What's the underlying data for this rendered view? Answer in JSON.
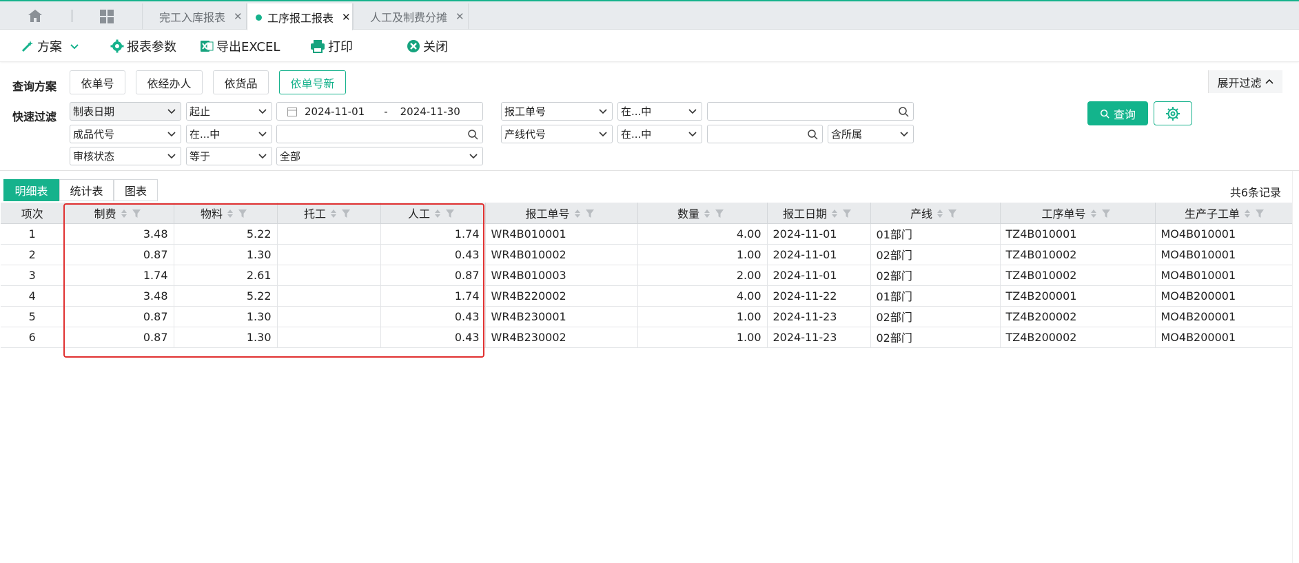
{
  "tabs": [
    {
      "label": "完工入库报表",
      "active": false
    },
    {
      "label": "工序报工报表",
      "active": true
    },
    {
      "label": "人工及制费分摊",
      "active": false
    }
  ],
  "toolbar": {
    "scheme": "方案",
    "params": "报表参数",
    "export": "导出EXCEL",
    "print": "打印",
    "close": "关闭"
  },
  "filter": {
    "scheme_label": "查询方案",
    "quick_label": "快速过滤",
    "schemes": [
      "依单号",
      "依经办人",
      "依货品",
      "依单号新"
    ],
    "expand": "展开过滤",
    "query": "查询",
    "row1": {
      "field": "制表日期",
      "op": "起止",
      "date_from": "2024-11-01",
      "date_sep": "-",
      "date_to": "2024-11-30",
      "field2": "报工单号",
      "op2": "在...中",
      "value2": ""
    },
    "row2": {
      "field": "成品代号",
      "op": "在...中",
      "value": "",
      "field2": "产线代号",
      "op2": "在...中",
      "value2": "",
      "extra": "含所属"
    },
    "row3": {
      "field": "审核状态",
      "op": "等于",
      "value": "全部"
    }
  },
  "view_tabs": [
    "明细表",
    "统计表",
    "图表"
  ],
  "record_count": "共6条记录",
  "table": {
    "headers": [
      "项次",
      "制费",
      "物料",
      "托工",
      "人工",
      "报工单号",
      "数量",
      "报工日期",
      "产线",
      "工序单号",
      "生产子工单"
    ],
    "rows": [
      [
        "1",
        "3.48",
        "5.22",
        "",
        "1.74",
        "WR4B010001",
        "4.00",
        "2024-11-01",
        "01部门",
        "TZ4B010001",
        "MO4B010001"
      ],
      [
        "2",
        "0.87",
        "1.30",
        "",
        "0.43",
        "WR4B010002",
        "1.00",
        "2024-11-01",
        "02部门",
        "TZ4B010002",
        "MO4B010001"
      ],
      [
        "3",
        "1.74",
        "2.61",
        "",
        "0.87",
        "WR4B010003",
        "2.00",
        "2024-11-01",
        "02部门",
        "TZ4B010002",
        "MO4B010001"
      ],
      [
        "4",
        "3.48",
        "5.22",
        "",
        "1.74",
        "WR4B220002",
        "4.00",
        "2024-11-22",
        "01部门",
        "TZ4B200001",
        "MO4B200001"
      ],
      [
        "5",
        "0.87",
        "1.30",
        "",
        "0.43",
        "WR4B230001",
        "1.00",
        "2024-11-23",
        "02部门",
        "TZ4B200002",
        "MO4B200001"
      ],
      [
        "6",
        "0.87",
        "1.30",
        "",
        "0.43",
        "WR4B230002",
        "1.00",
        "2024-11-23",
        "02部门",
        "TZ4B200002",
        "MO4B200001"
      ]
    ]
  },
  "colors": {
    "accent": "#16b28c",
    "highlight": "#e03030",
    "link": "#16a37e"
  }
}
